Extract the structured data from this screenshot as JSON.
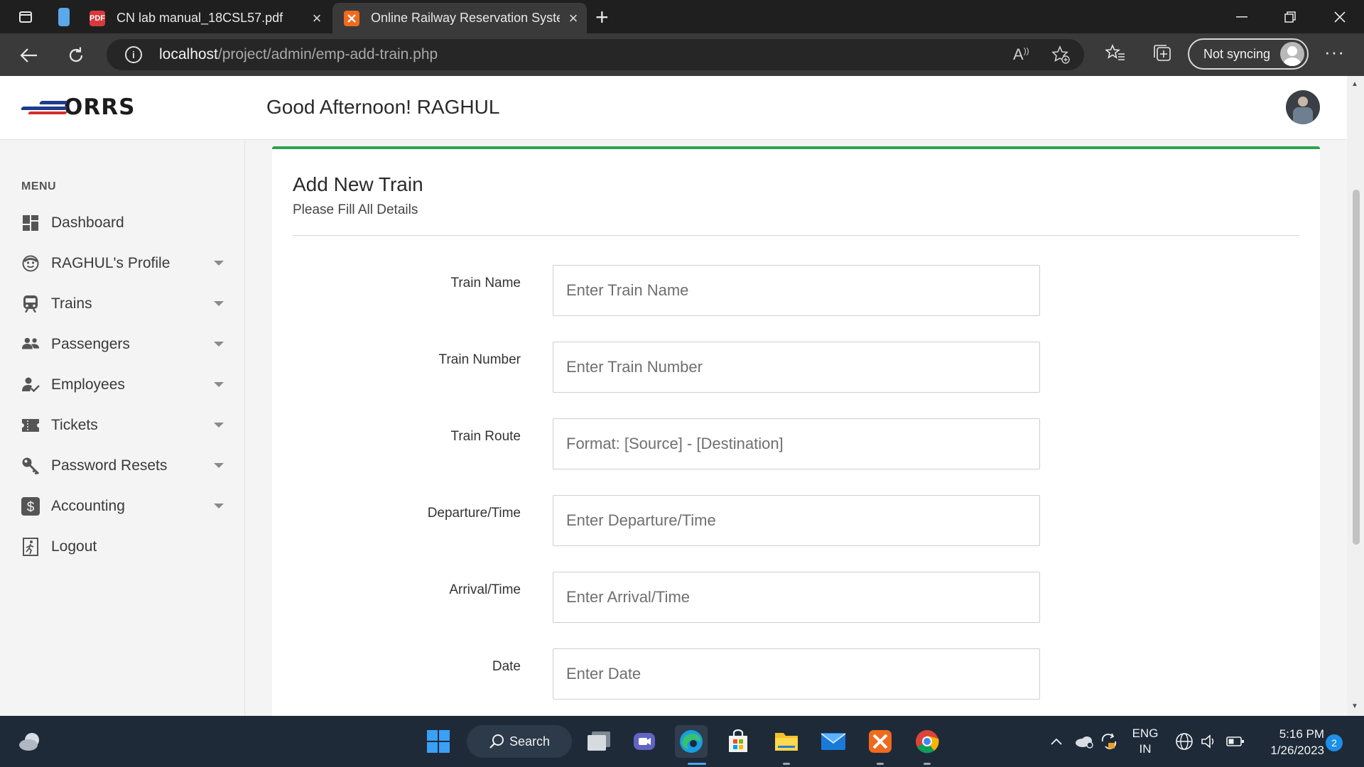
{
  "browser": {
    "tabs": [
      {
        "title": "CN lab manual_18CSL57.pdf",
        "favicon": "pdf-icon"
      },
      {
        "title": "Online Railway Reservation Syste",
        "favicon": "xampp-icon"
      }
    ],
    "url_host": "localhost",
    "url_path": "/project/admin/emp-add-train.php",
    "sync_label": "Not syncing"
  },
  "header": {
    "logo_text": "ORRS",
    "greeting": "Good Afternoon! RAGHUL"
  },
  "sidebar": {
    "menu_heading": "MENU",
    "items": [
      {
        "label": "Dashboard",
        "icon": "dashboard-icon",
        "has_caret": false
      },
      {
        "label": "RAGHUL's Profile",
        "icon": "face-icon",
        "has_caret": true
      },
      {
        "label": "Trains",
        "icon": "train-icon",
        "has_caret": true
      },
      {
        "label": "Passengers",
        "icon": "people-icon",
        "has_caret": true
      },
      {
        "label": "Employees",
        "icon": "employee-icon",
        "has_caret": true
      },
      {
        "label": "Tickets",
        "icon": "ticket-icon",
        "has_caret": true
      },
      {
        "label": "Password Resets",
        "icon": "key-icon",
        "has_caret": true
      },
      {
        "label": "Accounting",
        "icon": "dollar-icon",
        "has_caret": true
      },
      {
        "label": "Logout",
        "icon": "logout-icon",
        "has_caret": false
      }
    ]
  },
  "form": {
    "title": "Add New Train",
    "subtitle": "Please Fill All Details",
    "fields": [
      {
        "label": "Train Name",
        "placeholder": "Enter Train Name",
        "value": ""
      },
      {
        "label": "Train Number",
        "placeholder": "Enter Train Number",
        "value": ""
      },
      {
        "label": "Train Route",
        "placeholder": "Format: [Source] - [Destination]",
        "value": ""
      },
      {
        "label": "Departure/Time",
        "placeholder": "Enter Departure/Time",
        "value": ""
      },
      {
        "label": "Arrival/Time",
        "placeholder": "Enter Arrival/Time",
        "value": ""
      },
      {
        "label": "Date",
        "placeholder": "Enter Date",
        "value": ""
      }
    ]
  },
  "taskbar": {
    "search_label": "Search",
    "lang_line1": "ENG",
    "lang_line2": "IN",
    "time": "5:16 PM",
    "date": "1/26/2023",
    "notification_count": "2"
  },
  "colors": {
    "accent_green": "#2ea44f",
    "taskbar_bg": "#1e2a38",
    "chrome_dark": "#1f1f1f"
  }
}
